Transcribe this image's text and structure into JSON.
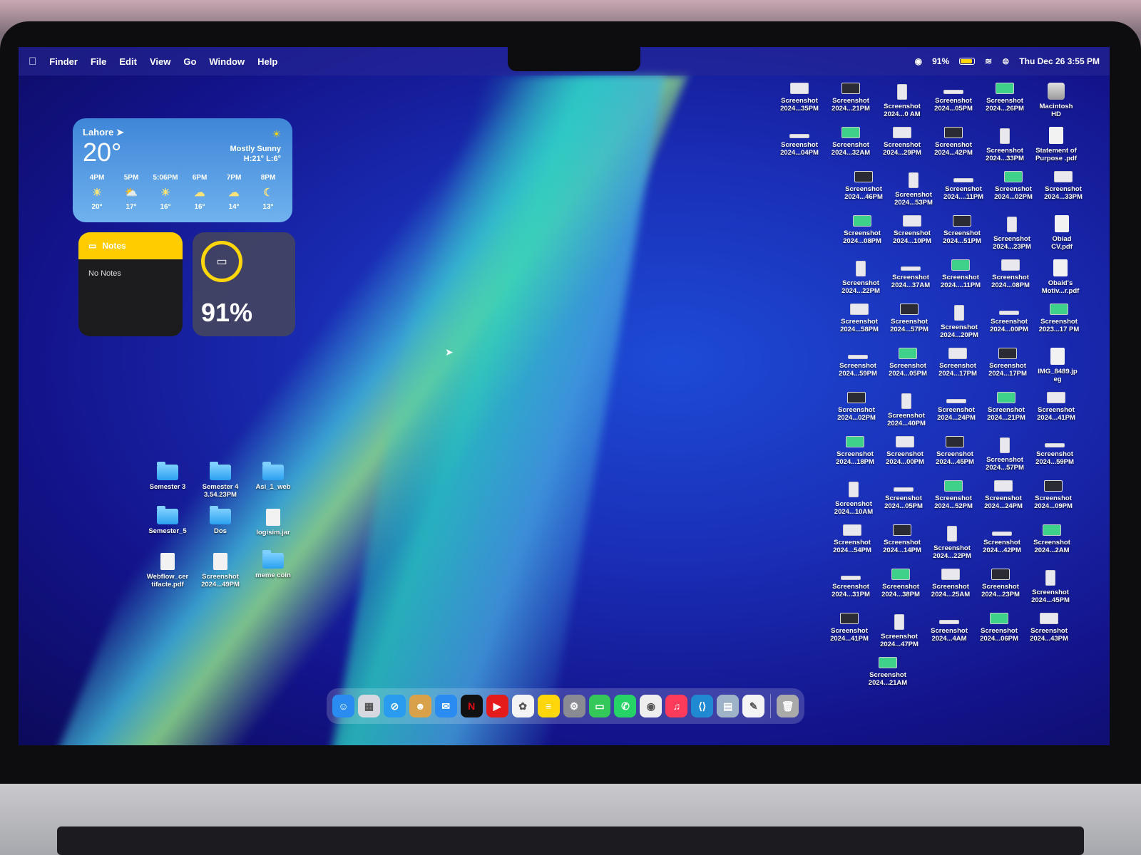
{
  "menubar": {
    "apple": "",
    "items": [
      "Finder",
      "File",
      "Edit",
      "View",
      "Go",
      "Window",
      "Help"
    ],
    "status": {
      "battery": "91%",
      "datetime": "Thu Dec 26  3:55 PM"
    }
  },
  "weather": {
    "city": "Lahore",
    "temp": "20°",
    "condition": "Mostly Sunny",
    "hilo": "H:21° L:6°",
    "hours": [
      {
        "time": "4PM",
        "icon": "☀",
        "temp": "20°"
      },
      {
        "time": "5PM",
        "icon": "⛅",
        "temp": "17°"
      },
      {
        "time": "5:06PM",
        "icon": "☀",
        "temp": "16°"
      },
      {
        "time": "6PM",
        "icon": "☁",
        "temp": "16°"
      },
      {
        "time": "7PM",
        "icon": "☁",
        "temp": "14°"
      },
      {
        "time": "8PM",
        "icon": "☾",
        "temp": "13°"
      }
    ]
  },
  "notes": {
    "title": "Notes",
    "body": "No Notes"
  },
  "battery_widget": {
    "percent": "91%"
  },
  "left_items": [
    [
      "Semester 3",
      ""
    ],
    [
      "Semester 4",
      "3.54.23PM"
    ],
    [
      "Asi_1_web",
      ""
    ],
    [
      "Semester_5",
      ""
    ],
    [
      "Dos",
      ""
    ],
    [
      "logisim.jar",
      ""
    ],
    [
      "Webflow_cer",
      "tifacte.pdf"
    ],
    [
      "Screenshot",
      "2024...49PM"
    ],
    [
      "meme coin",
      ""
    ]
  ],
  "right_rows": [
    [
      [
        "Screenshot",
        "2024...35PM"
      ],
      [
        "Screenshot",
        "2024...21PM"
      ],
      [
        "Screenshot",
        "2024...0 AM"
      ],
      [
        "Screenshot",
        "2024...05PM"
      ],
      [
        "Screenshot",
        "2024...26PM"
      ],
      [
        "Macintosh",
        "HD"
      ]
    ],
    [
      [
        "Screenshot",
        "2024...04PM"
      ],
      [
        "Screenshot",
        "2024...32AM"
      ],
      [
        "Screenshot",
        "2024...29PM"
      ],
      [
        "Screenshot",
        "2024...42PM"
      ],
      [
        "Screenshot",
        "2024...33PM"
      ],
      [
        "Statement of",
        "Purpose .pdf"
      ]
    ],
    [
      [
        "Screenshot",
        "2024...46PM"
      ],
      [
        "Screenshot",
        "2024...53PM"
      ],
      [
        "Screenshot",
        "2024....11PM"
      ],
      [
        "Screenshot",
        "2024...02PM"
      ],
      [
        "Screenshot",
        "2024...33PM"
      ]
    ],
    [
      [
        "Screenshot",
        "2024...08PM"
      ],
      [
        "Screenshot",
        "2024...10PM"
      ],
      [
        "Screenshot",
        "2024...51PM"
      ],
      [
        "Screenshot",
        "2024...23PM"
      ],
      [
        "Obiad",
        "CV.pdf"
      ]
    ],
    [
      [
        "Screenshot",
        "2024...22PM"
      ],
      [
        "Screenshot",
        "2024...37AM"
      ],
      [
        "Screenshot",
        "2024....11PM"
      ],
      [
        "Screenshot",
        "2024...08PM"
      ],
      [
        "Obaid's",
        "Motiv...r.pdf"
      ]
    ],
    [
      [
        "Screenshot",
        "2024...58PM"
      ],
      [
        "Screenshot",
        "2024...57PM"
      ],
      [
        "Screenshot",
        "2024...20PM"
      ],
      [
        "Screenshot",
        "2024...00PM"
      ],
      [
        "Screenshot",
        "2023...17 PM"
      ]
    ],
    [
      [
        "Screenshot",
        "2024...59PM"
      ],
      [
        "Screenshot",
        "2024...05PM"
      ],
      [
        "Screenshot",
        "2024...17PM"
      ],
      [
        "Screenshot",
        "2024...17PM"
      ],
      [
        "IMG_8489.jp",
        "eg"
      ]
    ],
    [
      [
        "Screenshot",
        "2024...02PM"
      ],
      [
        "Screenshot",
        "2024...40PM"
      ],
      [
        "Screenshot",
        "2024...24PM"
      ],
      [
        "Screenshot",
        "2024...21PM"
      ],
      [
        "Screenshot",
        "2024...41PM"
      ]
    ],
    [
      [
        "Screenshot",
        "2024...18PM"
      ],
      [
        "Screenshot",
        "2024...00PM"
      ],
      [
        "Screenshot",
        "2024...45PM"
      ],
      [
        "Screenshot",
        "2024...57PM"
      ],
      [
        "Screenshot",
        "2024...59PM"
      ]
    ],
    [
      [
        "Screenshot",
        "2024...10AM"
      ],
      [
        "Screenshot",
        "2024...05PM"
      ],
      [
        "Screenshot",
        "2024...52PM"
      ],
      [
        "Screenshot",
        "2024...24PM"
      ],
      [
        "Screenshot",
        "2024...09PM"
      ]
    ],
    [
      [
        "Screenshot",
        "2024...54PM"
      ],
      [
        "Screenshot",
        "2024...14PM"
      ],
      [
        "Screenshot",
        "2024...22PM"
      ],
      [
        "Screenshot",
        "2024...42PM"
      ],
      [
        "Screenshot",
        "2024...2AM"
      ]
    ],
    [
      [
        "Screenshot",
        "2024...31PM"
      ],
      [
        "Screenshot",
        "2024...38PM"
      ],
      [
        "Screenshot",
        "2024...25AM"
      ],
      [
        "Screenshot",
        "2024...23PM"
      ],
      [
        "Screenshot",
        "2024...45PM"
      ]
    ],
    [
      [
        "Screenshot",
        "2024...41PM"
      ],
      [
        "Screenshot",
        "2024...47PM"
      ],
      [
        "Screenshot",
        "2024...4AM"
      ],
      [
        "Screenshot",
        "2024...06PM"
      ],
      [
        "Screenshot",
        "2024...43PM"
      ]
    ],
    [
      [
        "Screenshot",
        "2024...21AM"
      ]
    ]
  ],
  "dock": [
    {
      "name": "finder",
      "glyph": "☺",
      "color": "#2a8cf0"
    },
    {
      "name": "launchpad",
      "glyph": "▦",
      "color": "#d8d8e0"
    },
    {
      "name": "safari",
      "glyph": "⊘",
      "color": "#2a9cf0"
    },
    {
      "name": "contacts",
      "glyph": "☻",
      "color": "#d9a24a"
    },
    {
      "name": "mail",
      "glyph": "✉",
      "color": "#2a8cf0"
    },
    {
      "name": "netflix",
      "glyph": "N",
      "color": "#111"
    },
    {
      "name": "youtube",
      "glyph": "▶",
      "color": "#e51b1b"
    },
    {
      "name": "photos",
      "glyph": "✿",
      "color": "#f4f4f4"
    },
    {
      "name": "notes",
      "glyph": "≡",
      "color": "#ffd60a"
    },
    {
      "name": "settings",
      "glyph": "⚙",
      "color": "#8a8a92"
    },
    {
      "name": "facetime",
      "glyph": "▭",
      "color": "#34c759"
    },
    {
      "name": "whatsapp",
      "glyph": "✆",
      "color": "#25d366"
    },
    {
      "name": "chrome",
      "glyph": "◉",
      "color": "#eee"
    },
    {
      "name": "music",
      "glyph": "♫",
      "color": "#ff3b5c"
    },
    {
      "name": "vscode",
      "glyph": "⟨⟩",
      "color": "#1f8ad2"
    },
    {
      "name": "preview",
      "glyph": "▤",
      "color": "#9fb3c8"
    },
    {
      "name": "textedit",
      "glyph": "✎",
      "color": "#f4f4f4"
    },
    {
      "name": "trash",
      "glyph": "🗑",
      "color": "#aaa"
    }
  ]
}
